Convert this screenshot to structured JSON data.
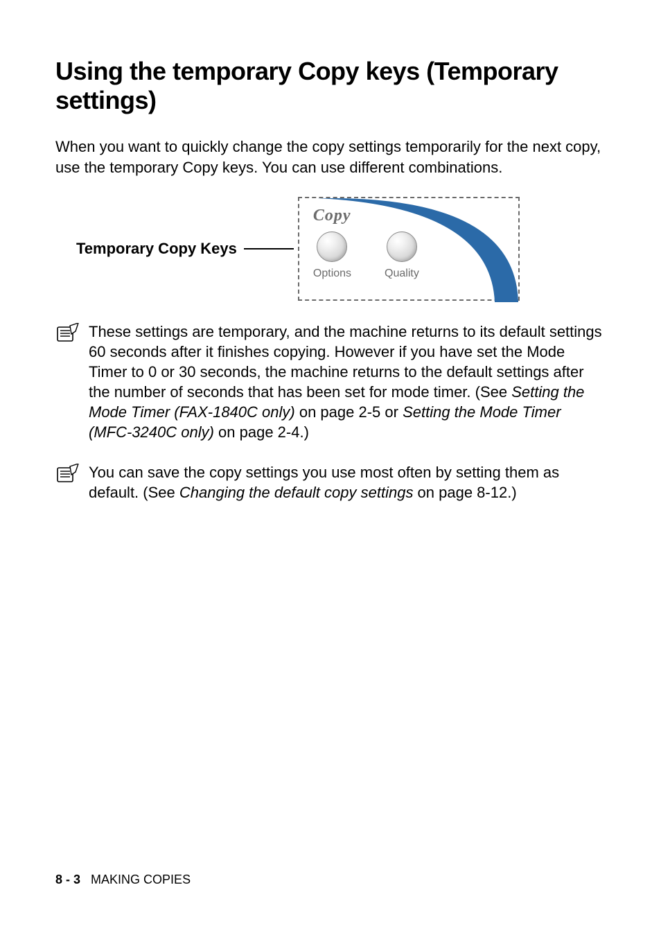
{
  "heading": "Using the temporary Copy keys (Temporary settings)",
  "intro": "When you want to quickly change the copy settings temporarily for the next copy, use the temporary Copy keys. You can use different combinations.",
  "diagram": {
    "label": "Temporary Copy Keys",
    "section_title": "Copy",
    "buttons": [
      "Options",
      "Quality"
    ]
  },
  "notes": {
    "n1_a": "These settings are temporary, and the machine returns to its default settings 60 seconds after it finishes copying. However if you have set the Mode Timer to 0 or 30 seconds, the machine returns to the default settings after the number of seconds that has been set for mode timer. (See ",
    "n1_i1": "Setting the Mode Timer (FAX-1840C only)",
    "n1_b": " on page 2-5 or ",
    "n1_i2": "Setting the Mode Timer (MFC-3240C only)",
    "n1_c": " on page 2-4.)",
    "n2_a": "You can save the copy settings you use most often by setting them as default. (See ",
    "n2_i1": "Changing the default copy settings",
    "n2_b": " on page 8-12.)"
  },
  "footer": {
    "page_num": "8 - 3",
    "section": "MAKING COPIES"
  }
}
